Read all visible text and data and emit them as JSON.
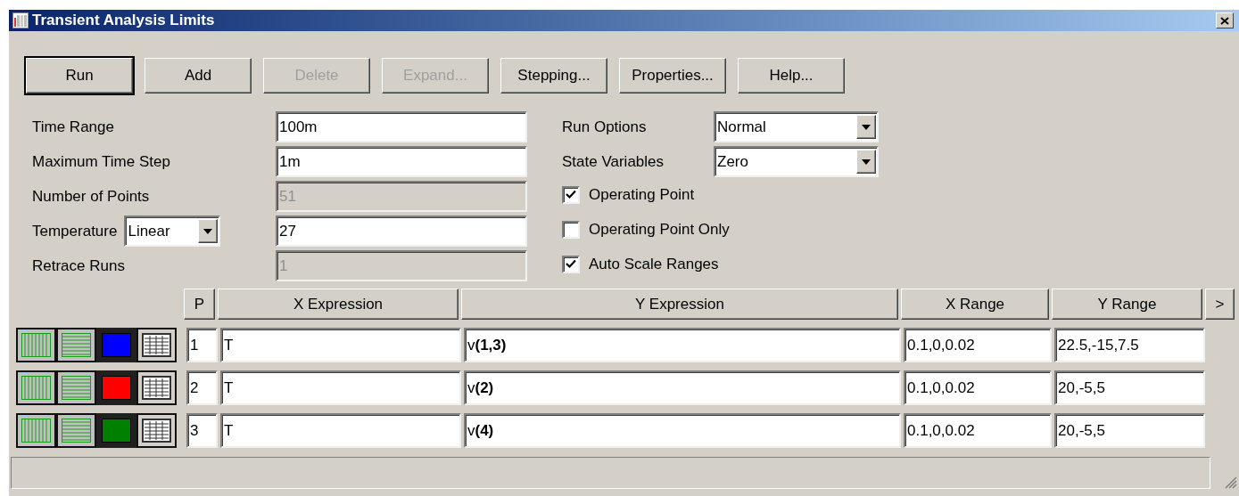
{
  "window": {
    "title": "Transient Analysis Limits"
  },
  "buttons": [
    {
      "label": "Run",
      "disabled": false,
      "default": true
    },
    {
      "label": "Add",
      "disabled": false,
      "default": false
    },
    {
      "label": "Delete",
      "disabled": true,
      "default": false
    },
    {
      "label": "Expand...",
      "disabled": true,
      "default": false
    },
    {
      "label": "Stepping...",
      "disabled": false,
      "default": false
    },
    {
      "label": "Properties...",
      "disabled": false,
      "default": false
    },
    {
      "label": "Help...",
      "disabled": false,
      "default": false
    }
  ],
  "fields": [
    {
      "label": "Time Range",
      "value": "100m",
      "disabled": false
    },
    {
      "label": "Maximum Time Step",
      "value": "1m",
      "disabled": false
    },
    {
      "label": "Number of Points",
      "value": "51",
      "disabled": true
    },
    {
      "label": "Temperature",
      "mode": "Linear",
      "value": "27",
      "disabled": false
    },
    {
      "label": "Retrace Runs",
      "value": "1",
      "disabled": true
    }
  ],
  "dropdowns": [
    {
      "label": "Run Options",
      "value": "Normal"
    },
    {
      "label": "State Variables",
      "value": "Zero"
    }
  ],
  "checkboxes": [
    {
      "label": "Operating Point",
      "checked": true
    },
    {
      "label": "Operating Point Only",
      "checked": false
    },
    {
      "label": "Auto Scale Ranges",
      "checked": true
    }
  ],
  "table": {
    "columns": [
      "P",
      "X Expression",
      "Y Expression",
      "X Range",
      "Y Range"
    ],
    "more": ">",
    "rows": [
      {
        "color": "#0000ff",
        "p": "1",
        "x_expression": "T",
        "y_expression": "v**(1,3)**",
        "x_range": "0.1,0,0.02",
        "y_range": "22.5,-15,7.5"
      },
      {
        "color": "#ff0000",
        "p": "2",
        "x_expression": "T",
        "y_expression": "v**(2)**",
        "x_range": "0.1,0,0.02",
        "y_range": "20,-5,5"
      },
      {
        "color": "#008000",
        "p": "3",
        "x_expression": "T",
        "y_expression": "v**(4)**",
        "x_range": "0.1,0,0.02",
        "y_range": "20,-5,5"
      }
    ]
  }
}
